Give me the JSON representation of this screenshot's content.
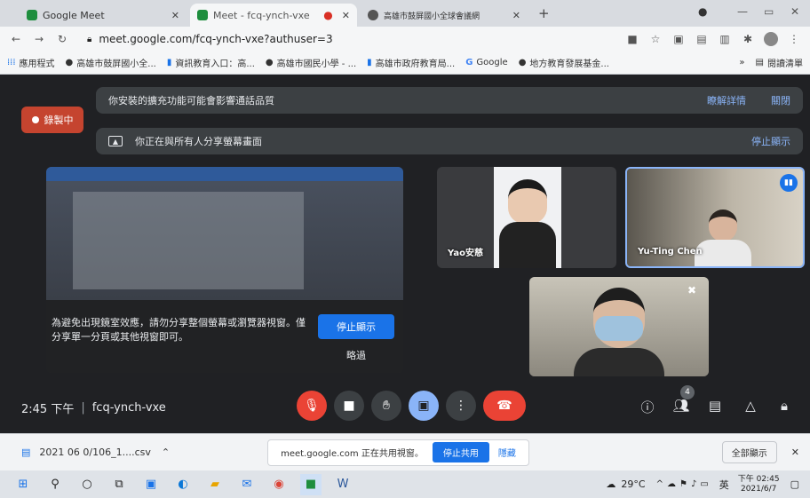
{
  "browser": {
    "tabs": [
      {
        "title": "Google Meet",
        "active": false
      },
      {
        "title": "Meet - fcq-ynch-vxe",
        "active": true
      },
      {
        "title": "高雄市鼓屏國小全球會議網",
        "active": false
      }
    ],
    "new_tab": "+",
    "url": "meet.google.com/fcq-ynch-vxe?authuser=3",
    "bookmarks": [
      "應用程式",
      "高雄市鼓屏國小全...",
      "資訊教育入口：高...",
      "高雄市國民小學 - ...",
      "高雄市政府教育局...",
      "Google",
      "地方教育發展基金..."
    ],
    "reading_list": "閱讀清單"
  },
  "meet": {
    "recording_label": "錄製中",
    "notice1": {
      "text": "你安裝的擴充功能可能會影響通話品質",
      "learn_more": "瞭解詳情",
      "close": "關閉"
    },
    "notice2": {
      "text": "你正在與所有人分享螢幕畫面",
      "stop": "停止顯示"
    },
    "share_warning": "為避免出現鏡室效應，請勿分享整個螢幕或瀏覽器視窗。僅分享單一分頁或其他視窗即可。",
    "stop_showing": "停止顯示",
    "dismiss": "略過",
    "participants": [
      {
        "name": "Yao安慈"
      },
      {
        "name": "Yu-Ting Chen"
      }
    ],
    "time": "2:45 下午",
    "meeting_code": "fcq-ynch-vxe",
    "people_count": "4"
  },
  "downloads": {
    "file": "2021 06 0/106_1....csv",
    "sharing_text": "meet.google.com 正在共用視窗。",
    "stop_share": "停止共用",
    "hide": "隱藏",
    "show_all": "全部顯示"
  },
  "taskbar": {
    "weather": "29°C",
    "ime": "英",
    "time": "下午 02:45",
    "date": "2021/6/7"
  },
  "colors": {
    "meet_bg": "#202124",
    "recording": "#c5442f",
    "accent": "#8ab4f8",
    "end_call": "#ea4335"
  }
}
